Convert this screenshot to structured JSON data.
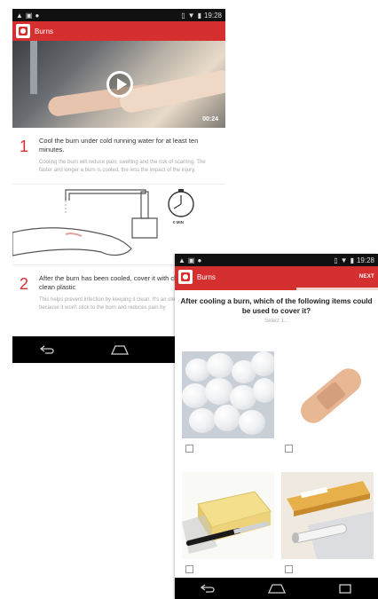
{
  "phone1": {
    "status": {
      "time": "19:28"
    },
    "appbar": {
      "title": "Burns"
    },
    "video": {
      "duration": "00:24"
    },
    "steps": [
      {
        "number": "1",
        "title": "Cool the burn under cold running water for at least ten minutes.",
        "description": "Cooling the burn will reduce pain, swelling and the risk of scarring. The faster and longer a burn is cooled, the less the impact of the injury."
      },
      {
        "number": "2",
        "title": "After the burn has been cooled, cover it with cling film or a clean plastic",
        "description": "This helps prevent infection by keeping it clean. It's an ideal covering because it won't stick to the burn and reduces pain by"
      }
    ],
    "illustration": {
      "timer_label": "0 MIN"
    }
  },
  "phone2": {
    "status": {
      "time": "19:28"
    },
    "appbar": {
      "title": "Burns",
      "next_label": "NEXT"
    },
    "progress": {
      "fraction": 0.6
    },
    "question": "After cooling a burn, which of the following items could be used to cover it?",
    "hint": "Select 1...",
    "options": [
      {
        "icon": "cotton-wool-image"
      },
      {
        "icon": "plaster-image"
      },
      {
        "icon": "butter-image"
      },
      {
        "icon": "cling-film-image"
      }
    ]
  },
  "colors": {
    "accent": "#d62f2f",
    "status_bar": "#111111",
    "nav_bar": "#000000"
  }
}
